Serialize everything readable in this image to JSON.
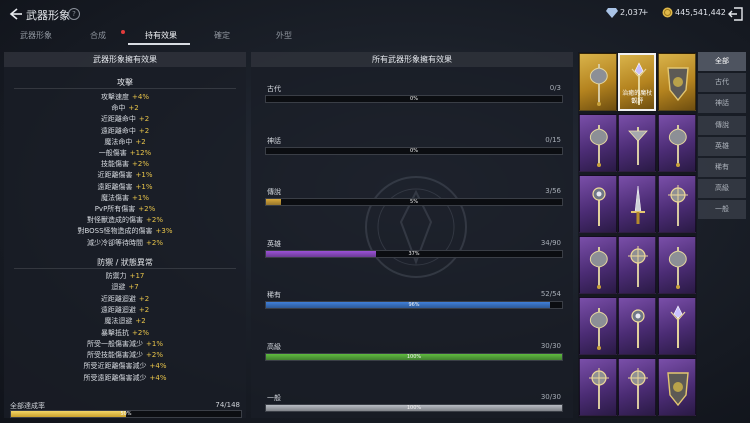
{
  "header": {
    "title": "武器形象",
    "help_label": "?",
    "diamond_amount": "2,037",
    "gold_amount": "445,541,442",
    "colors": {
      "diamond": "#a9c3e6",
      "gold": "#e0b94a"
    }
  },
  "tabs": [
    {
      "label": "武器形象"
    },
    {
      "label": "合成"
    },
    {
      "label": "持有效果"
    },
    {
      "label": "確定"
    },
    {
      "label": "外型"
    }
  ],
  "active_tab": "持有效果",
  "left_panel": {
    "heading": "武器形象擁有效果",
    "attack_title": "攻擊",
    "attack_stats": [
      {
        "name": "攻擊速度",
        "value": "+4%"
      },
      {
        "name": "命中",
        "value": "+2"
      },
      {
        "name": "近距離命中",
        "value": "+2"
      },
      {
        "name": "遠距離命中",
        "value": "+2"
      },
      {
        "name": "魔法命中",
        "value": "+2"
      },
      {
        "name": "一般傷害",
        "value": "+12%"
      },
      {
        "name": "技能傷害",
        "value": "+2%"
      },
      {
        "name": "近距離傷害",
        "value": "+1%"
      },
      {
        "name": "遠距離傷害",
        "value": "+1%"
      },
      {
        "name": "魔法傷害",
        "value": "+1%"
      },
      {
        "name": "PvP所有傷害",
        "value": "+2%"
      },
      {
        "name": "對怪獸造成的傷害",
        "value": "+2%"
      },
      {
        "name": "對BOSS怪物造成的傷害",
        "value": "+3%"
      },
      {
        "name": "減少冷卻等待時間",
        "value": "+2%"
      }
    ],
    "defense_title": "防禦 / 狀態異常",
    "defense_stats": [
      {
        "name": "防禦力",
        "value": "+17"
      },
      {
        "name": "迴避",
        "value": "+7"
      },
      {
        "name": "近距離迴避",
        "value": "+2"
      },
      {
        "name": "遠距離迴避",
        "value": "+2"
      },
      {
        "name": "魔法迴避",
        "value": "+2"
      },
      {
        "name": "暴擊抵抗",
        "value": "+2%"
      },
      {
        "name": "所受一般傷害減少",
        "value": "+1%"
      },
      {
        "name": "所受技能傷害減少",
        "value": "+2%"
      },
      {
        "name": "所受近距離傷害減少",
        "value": "+4%"
      },
      {
        "name": "所受遠距離傷害減少",
        "value": "+4%"
      }
    ],
    "overall": {
      "label": "全部達成率",
      "count": "74/148",
      "percent_label": "50%",
      "fraction": 0.5
    }
  },
  "mid_panel": {
    "heading": "所有武器形象擁有效果",
    "rarities": [
      {
        "name": "古代",
        "count": "0/3",
        "percent_label": "0%",
        "fraction": 0.0,
        "color": "#e0a94a"
      },
      {
        "name": "神話",
        "count": "0/15",
        "percent_label": "0%",
        "fraction": 0.0,
        "color": "#e06b4a"
      },
      {
        "name": "傳說",
        "count": "3/56",
        "percent_label": "5%",
        "fraction": 0.05,
        "color": "#d9a93a"
      },
      {
        "name": "英雄",
        "count": "34/90",
        "percent_label": "37%",
        "fraction": 0.37,
        "color": "#9b52d6"
      },
      {
        "name": "稀有",
        "count": "52/54",
        "percent_label": "96%",
        "fraction": 0.96,
        "color": "#3f7fd9"
      },
      {
        "name": "高級",
        "count": "30/30",
        "percent_label": "100%",
        "fraction": 1.0,
        "color": "#5fbb3f"
      },
      {
        "name": "一般",
        "count": "30/30",
        "percent_label": "100%",
        "fraction": 1.0,
        "color": "#b9bdc4"
      }
    ]
  },
  "items": {
    "selected_label_line1": "治癒的魔杖",
    "selected_label_line2": "觀評",
    "rarity_rows": [
      "legend",
      "hero",
      "hero",
      "hero",
      "hero",
      "hero"
    ],
    "icons": [
      "axe-icon",
      "wand-icon",
      "shield-icon",
      "axe-icon",
      "staff-icon",
      "axe-icon",
      "orb-staff-icon",
      "sword-icon",
      "mace-icon",
      "axe-icon",
      "mace-icon",
      "axe-icon",
      "axe-icon",
      "orb-staff-icon",
      "wand-icon",
      "mace-icon",
      "mace-icon",
      "shield-icon"
    ]
  },
  "filters": [
    {
      "label": "全部"
    },
    {
      "label": "古代"
    },
    {
      "label": "神話"
    },
    {
      "label": "傳說"
    },
    {
      "label": "英雄"
    },
    {
      "label": "稀有"
    },
    {
      "label": "高級"
    },
    {
      "label": "一般"
    }
  ],
  "active_filter": "全部"
}
